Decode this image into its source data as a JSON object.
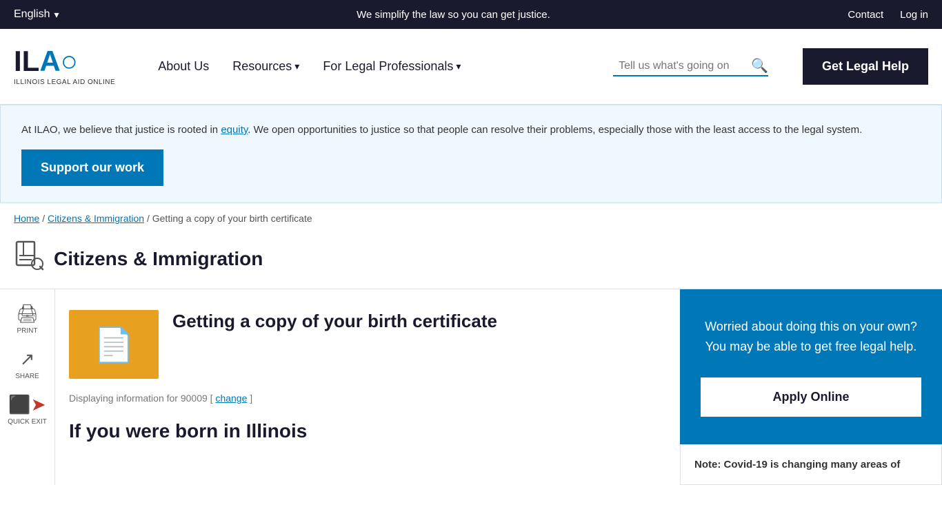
{
  "topbar": {
    "language": "English",
    "tagline": "We simplify the law so you can get justice.",
    "contact": "Contact",
    "login": "Log in"
  },
  "nav": {
    "logo_text": "ILA",
    "logo_o": "O",
    "logo_subtitle": "ILLINOIS LEGAL AID ONLINE",
    "about": "About Us",
    "resources": "Resources",
    "for_legal": "For Legal Professionals",
    "search_placeholder": "Tell us what's going on",
    "get_help": "Get Legal Help"
  },
  "banner": {
    "text": "At ILAO, we believe that justice is rooted in equity. We open opportunities to justice so that people can resolve their problems, especially those with the least access to the legal system.",
    "equity_link": "equity",
    "support_btn": "Support our work"
  },
  "breadcrumb": {
    "home": "Home",
    "category": "Citizens & Immigration",
    "current": "Getting a copy of your birth certificate"
  },
  "category": {
    "title": "Citizens & Immigration"
  },
  "sidebar": {
    "print": "PRINT",
    "share": "SHARE",
    "quick_exit": "QUICK EXIT"
  },
  "article": {
    "title": "Getting a copy of your birth certificate",
    "displaying_text": "Displaying information for 90009 [",
    "change_link": "change",
    "displaying_close": "]"
  },
  "section": {
    "title": "If you were born in Illinois"
  },
  "help_panel": {
    "line1": "Worried about doing this on your own?",
    "line2": "You may be able to get free legal help.",
    "apply_btn": "Apply Online"
  },
  "note_panel": {
    "text": "Note: Covid-19 is changing many areas of"
  },
  "colors": {
    "blue": "#0077b6",
    "dark": "#1a1a2e",
    "orange": "#e8a020"
  }
}
